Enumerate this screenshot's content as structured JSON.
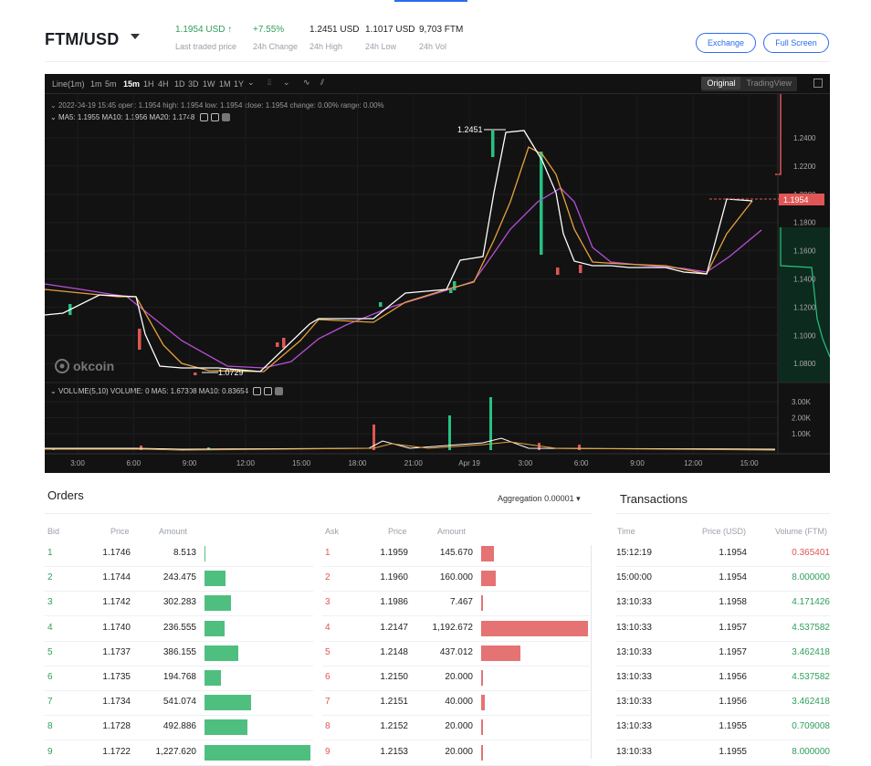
{
  "header": {
    "pair": "FTM/USD",
    "last_price": "1.1954 USD ↑",
    "last_price_label": "Last traded price",
    "change": "+7.55%",
    "change_label": "24h Change",
    "high": "1.2451 USD",
    "high_label": "24h High",
    "low": "1.1017 USD",
    "low_label": "24h Low",
    "vol": "9,703 FTM",
    "vol_label": "24h Vol",
    "exchange_btn": "Exchange",
    "fullscreen_btn": "Full Screen"
  },
  "chart": {
    "timeframes": [
      "Line(1m)",
      "1m",
      "5m",
      "15m",
      "1H",
      "4H",
      "1D",
      "3D",
      "1W",
      "1M",
      "1Y"
    ],
    "active_timeframe": "15m",
    "view_original": "Original",
    "view_tradingview": "TradingView",
    "ohlc_label": "2022-04-19 15:45  open: 1.1954  high: 1.1954  low: 1.1954  close: 1.1954  change: 0.00%  range: 0.00%",
    "ma_label": "MA5: 1.1955  MA10: 1.1956  MA20: 1.1748",
    "vol_label": "VOLUME(5,10)  VOLUME: 0  MA5: 1.67308  MA10: 0.83654",
    "watermark": "okcoin",
    "high_marker": "1.2451",
    "low_marker": "1.0729",
    "current_price_tag": "1.1954",
    "price_ticks": [
      "1.2400",
      "1.2200",
      "1.2000",
      "1.1800",
      "1.1600",
      "1.1400",
      "1.1200",
      "1.1000",
      "1.0800"
    ],
    "volume_ticks": [
      "3.00K",
      "2.00K",
      "1.00K"
    ],
    "time_ticks": [
      "3:00",
      "6:00",
      "9:00",
      "12:00",
      "15:00",
      "18:00",
      "21:00",
      "Apr 19",
      "3:00",
      "6:00",
      "9:00",
      "12:00",
      "15:00"
    ],
    "colors": {
      "up": "#26c281",
      "down": "#e05555",
      "ma5": "#ffffff",
      "ma10": "#e6a23c",
      "ma20": "#b84fd8"
    }
  },
  "orders": {
    "title": "Orders",
    "aggregation_label": "Aggregation",
    "aggregation_value": "0.00001",
    "bid_headers": [
      "Bid",
      "Price",
      "Amount"
    ],
    "ask_headers": [
      "Ask",
      "Price",
      "Amount"
    ],
    "bids": [
      {
        "n": "1",
        "price": "1.1746",
        "amount": "8.513",
        "depth": 0.007
      },
      {
        "n": "2",
        "price": "1.1744",
        "amount": "243.475",
        "depth": 0.2
      },
      {
        "n": "3",
        "price": "1.1742",
        "amount": "302.283",
        "depth": 0.25
      },
      {
        "n": "4",
        "price": "1.1740",
        "amount": "236.555",
        "depth": 0.193
      },
      {
        "n": "5",
        "price": "1.1737",
        "amount": "386.155",
        "depth": 0.315
      },
      {
        "n": "6",
        "price": "1.1735",
        "amount": "194.768",
        "depth": 0.159
      },
      {
        "n": "7",
        "price": "1.1734",
        "amount": "541.074",
        "depth": 0.441
      },
      {
        "n": "8",
        "price": "1.1728",
        "amount": "492.886",
        "depth": 0.402
      },
      {
        "n": "9",
        "price": "1.1722",
        "amount": "1,227.620",
        "depth": 1.0
      }
    ],
    "asks": [
      {
        "n": "1",
        "price": "1.1959",
        "amount": "145.670",
        "depth": 0.122
      },
      {
        "n": "2",
        "price": "1.1960",
        "amount": "160.000",
        "depth": 0.134
      },
      {
        "n": "3",
        "price": "1.1986",
        "amount": "7.467",
        "depth": 0.006
      },
      {
        "n": "4",
        "price": "1.2147",
        "amount": "1,192.672",
        "depth": 1.0
      },
      {
        "n": "5",
        "price": "1.2148",
        "amount": "437.012",
        "depth": 0.366
      },
      {
        "n": "6",
        "price": "1.2150",
        "amount": "20.000",
        "depth": 0.017
      },
      {
        "n": "7",
        "price": "1.2151",
        "amount": "40.000",
        "depth": 0.034
      },
      {
        "n": "8",
        "price": "1.2152",
        "amount": "20.000",
        "depth": 0.017
      },
      {
        "n": "9",
        "price": "1.2153",
        "amount": "20.000",
        "depth": 0.017
      }
    ]
  },
  "transactions": {
    "title": "Transactions",
    "headers": [
      "Time",
      "Price (USD)",
      "Volume (FTM)"
    ],
    "rows": [
      {
        "time": "15:12:19",
        "price": "1.1954",
        "volume": "0.365401",
        "side": "sell"
      },
      {
        "time": "15:00:00",
        "price": "1.1954",
        "volume": "8.000000",
        "side": "buy"
      },
      {
        "time": "13:10:33",
        "price": "1.1958",
        "volume": "4.171426",
        "side": "buy"
      },
      {
        "time": "13:10:33",
        "price": "1.1957",
        "volume": "4.537582",
        "side": "buy"
      },
      {
        "time": "13:10:33",
        "price": "1.1957",
        "volume": "3.462418",
        "side": "buy"
      },
      {
        "time": "13:10:33",
        "price": "1.1956",
        "volume": "4.537582",
        "side": "buy"
      },
      {
        "time": "13:10:33",
        "price": "1.1956",
        "volume": "3.462418",
        "side": "buy"
      },
      {
        "time": "13:10:33",
        "price": "1.1955",
        "volume": "0.709008",
        "side": "buy"
      },
      {
        "time": "13:10:33",
        "price": "1.1955",
        "volume": "8.000000",
        "side": "buy"
      }
    ]
  }
}
